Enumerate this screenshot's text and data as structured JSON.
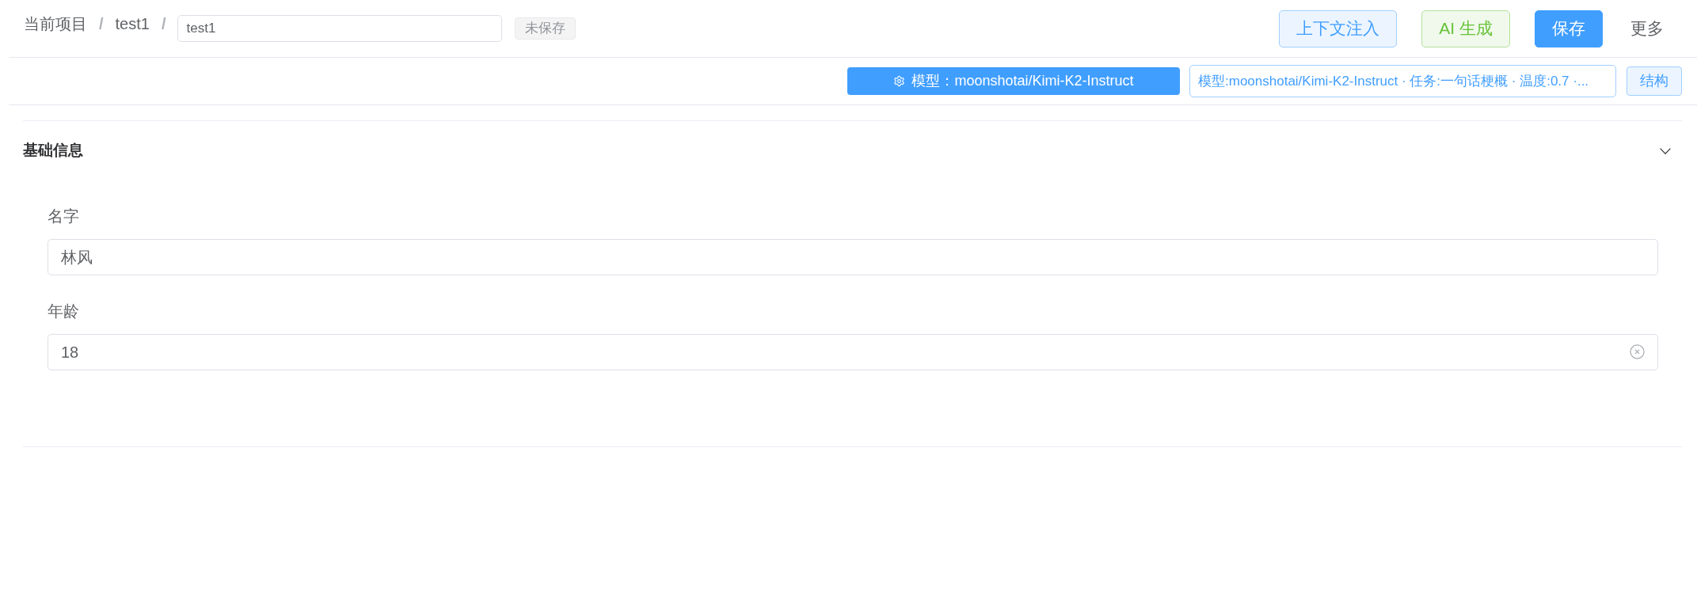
{
  "breadcrumb": [
    {
      "label": "当前项目",
      "separator": "/"
    },
    {
      "label": "test1",
      "separator": "/"
    }
  ],
  "title_input": {
    "value": "test1"
  },
  "status_badge": "未保存",
  "actions": [
    {
      "label": "上下文注入",
      "kind": "plain"
    },
    {
      "label": "AI 生成",
      "kind": "success"
    },
    {
      "label": "保存",
      "kind": "primary"
    },
    {
      "label": "更多",
      "kind": "text"
    }
  ],
  "toolbar": {
    "model_button": "模型：moonshotai/Kimi-K2-Instruct",
    "summary": "模型:moonshotai/Kimi-K2-Instruct · 任务:一句话梗概 · 温度:0.7 ·...",
    "structure_button": "结构"
  },
  "section": {
    "title": "基础信息",
    "expanded": true,
    "fields": [
      {
        "label": "名字",
        "value": "林风",
        "show_clear": false
      },
      {
        "label": "年龄",
        "value": "18",
        "show_clear": true
      }
    ]
  }
}
